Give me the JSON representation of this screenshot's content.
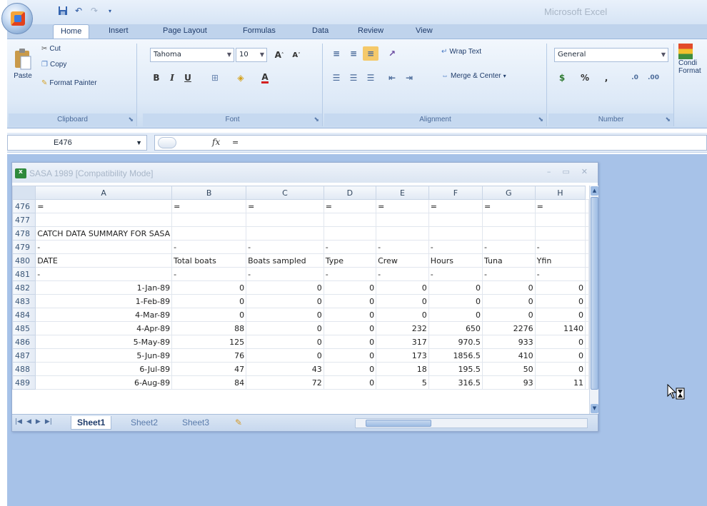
{
  "app": {
    "title": "Microsoft Excel"
  },
  "ribbon": {
    "tabs": [
      "Home",
      "Insert",
      "Page Layout",
      "Formulas",
      "Data",
      "Review",
      "View"
    ],
    "clipboard": {
      "paste": "Paste",
      "cut": "Cut",
      "copy": "Copy",
      "format_painter": "Format Painter",
      "label": "Clipboard"
    },
    "font": {
      "name": "Tahoma",
      "size": "10",
      "label": "Font"
    },
    "alignment": {
      "wrap_text": "Wrap Text",
      "merge_center": "Merge & Center",
      "label": "Alignment"
    },
    "number": {
      "format": "General",
      "label": "Number"
    },
    "styles": {
      "conditional": "Condi",
      "formatting": "Format"
    }
  },
  "formula_bar": {
    "name_box": "E476",
    "fx": "fx",
    "value": "="
  },
  "workbook": {
    "title": "SASA 1989  [Compatibility Mode]",
    "columns": [
      "A",
      "B",
      "C",
      "D",
      "E",
      "F",
      "G",
      "H"
    ],
    "rows": [
      {
        "n": "476",
        "cells": [
          "=",
          "=",
          "=",
          "=",
          "=",
          "=",
          "=",
          "="
        ]
      },
      {
        "n": "477",
        "cells": [
          "",
          "",
          "",
          "",
          "",
          "",
          "",
          ""
        ]
      },
      {
        "n": "478",
        "cells": [
          "CATCH DATA SUMMARY FOR SASA",
          "",
          "",
          "",
          "",
          "",
          "",
          ""
        ]
      },
      {
        "n": "479",
        "cells": [
          "-",
          "-",
          "-",
          "-",
          "-",
          "-",
          "-",
          "-"
        ]
      },
      {
        "n": "480",
        "cells": [
          "DATE",
          "Total boats",
          "Boats sampled",
          "Type",
          "Crew",
          "Hours",
          "Tuna",
          "Yfin"
        ]
      },
      {
        "n": "481",
        "cells": [
          "-",
          "-",
          "-",
          "-",
          "-",
          "-",
          "-",
          "-"
        ]
      },
      {
        "n": "482",
        "cells": [
          "1-Jan-89",
          "0",
          "0",
          "0",
          "0",
          "0",
          "0",
          "0"
        ]
      },
      {
        "n": "483",
        "cells": [
          "1-Feb-89",
          "0",
          "0",
          "0",
          "0",
          "0",
          "0",
          "0"
        ]
      },
      {
        "n": "484",
        "cells": [
          "4-Mar-89",
          "0",
          "0",
          "0",
          "0",
          "0",
          "0",
          "0"
        ]
      },
      {
        "n": "485",
        "cells": [
          "4-Apr-89",
          "88",
          "0",
          "0",
          "232",
          "650",
          "2276",
          "1140"
        ]
      },
      {
        "n": "486",
        "cells": [
          "5-May-89",
          "125",
          "0",
          "0",
          "317",
          "970.5",
          "933",
          "0"
        ]
      },
      {
        "n": "487",
        "cells": [
          "5-Jun-89",
          "76",
          "0",
          "0",
          "173",
          "1856.5",
          "410",
          "0"
        ]
      },
      {
        "n": "488",
        "cells": [
          "6-Jul-89",
          "47",
          "43",
          "0",
          "18",
          "195.5",
          "50",
          "0"
        ]
      },
      {
        "n": "489",
        "cells": [
          "6-Aug-89",
          "84",
          "72",
          "0",
          "5",
          "316.5",
          "93",
          "11"
        ]
      }
    ],
    "sheets": [
      "Sheet1",
      "Sheet2",
      "Sheet3"
    ]
  }
}
